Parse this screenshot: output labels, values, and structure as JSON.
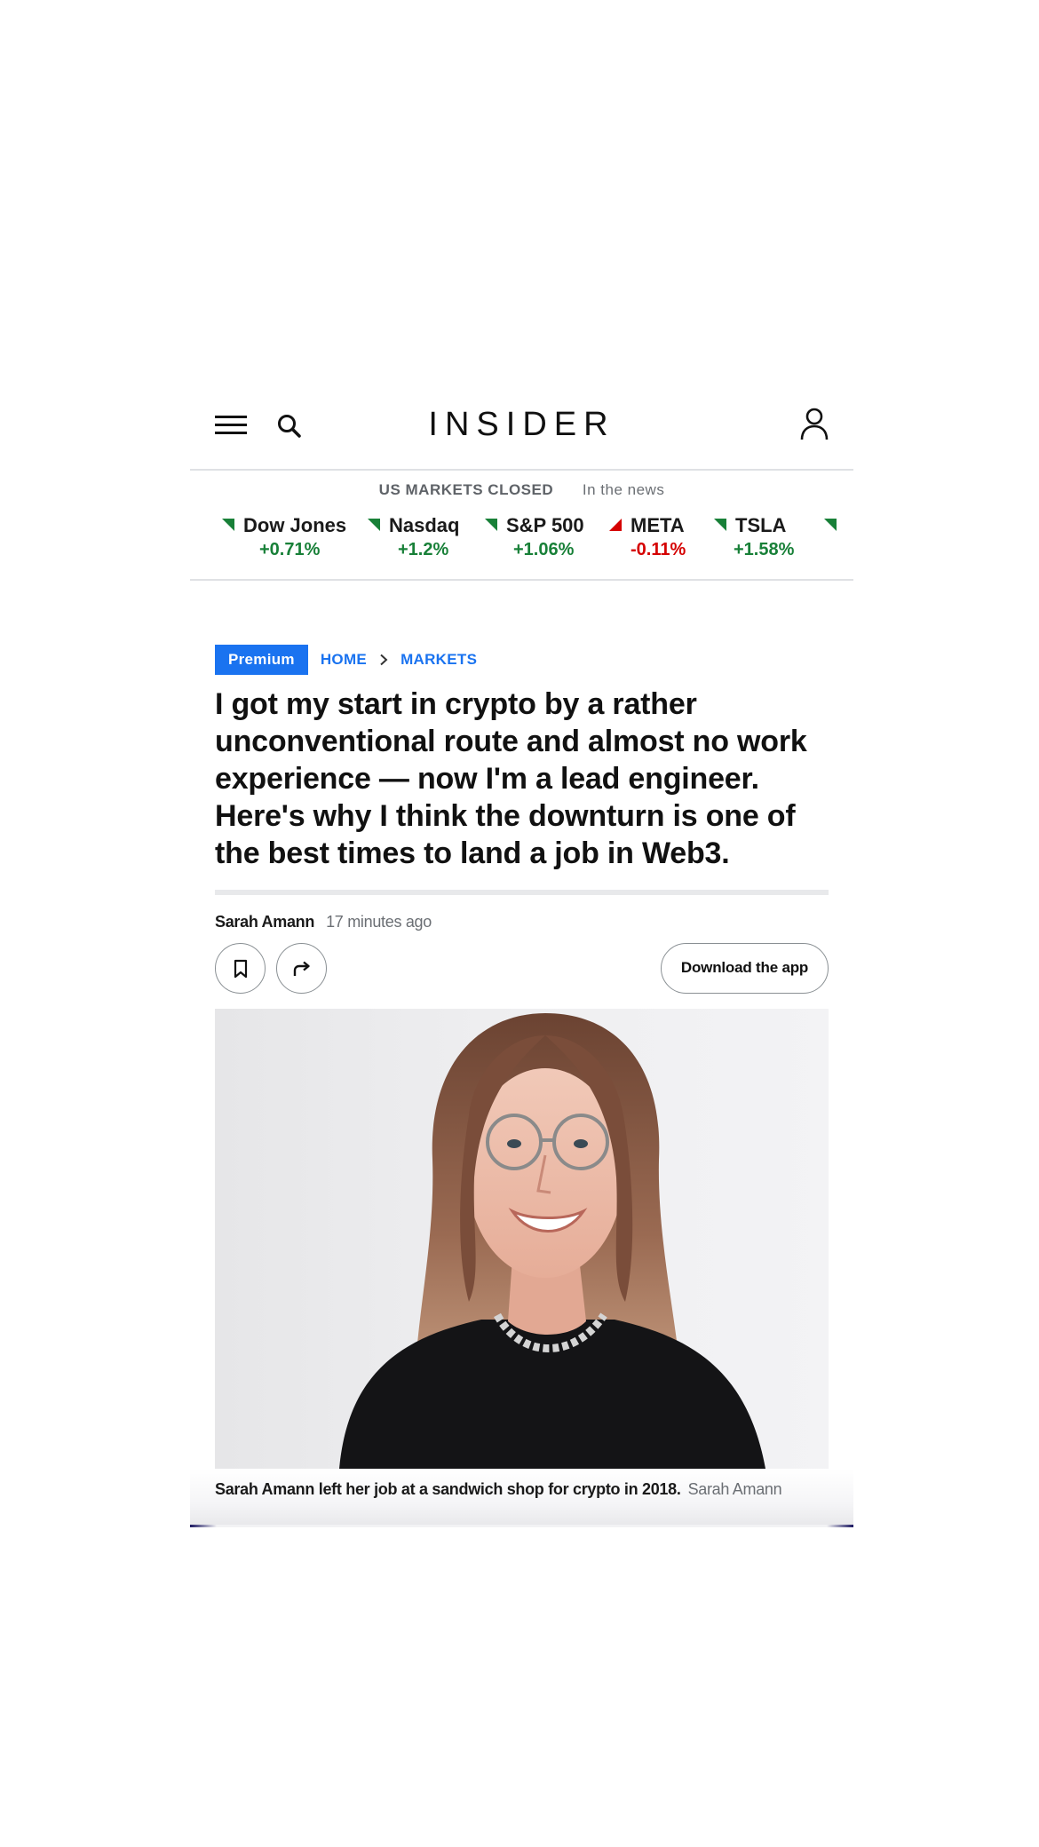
{
  "header": {
    "logo": "INSIDER",
    "icons": [
      "hamburger-menu-icon",
      "search-icon",
      "user-account-icon"
    ]
  },
  "markets": {
    "status": "US MARKETS CLOSED",
    "news_link": "In the news",
    "tickers": [
      {
        "name": "Dow Jones",
        "change": "+0.71%",
        "direction": "up"
      },
      {
        "name": "Nasdaq",
        "change": "+1.2%",
        "direction": "up"
      },
      {
        "name": "S&P 500",
        "change": "+1.06%",
        "direction": "up"
      },
      {
        "name": "META",
        "change": "-0.11%",
        "direction": "down"
      },
      {
        "name": "TSLA",
        "change": "+1.58%",
        "direction": "up"
      }
    ],
    "colors": {
      "up": "#188038",
      "down": "#d50000"
    }
  },
  "breadcrumb": {
    "badge": "Premium",
    "home": "HOME",
    "section": "MARKETS"
  },
  "article": {
    "headline": "I got my start in crypto by a rather unconventional route and almost no work experience — now I'm a lead engineer. Here's why I think the downturn is one of the best times to land a job in Web3.",
    "author": "Sarah Amann",
    "time": "17 minutes ago",
    "download_app": "Download the app",
    "caption": "Sarah Amann left her job at a sandwich shop for crypto in 2018.",
    "caption_credit": "Sarah Amann"
  },
  "colors": {
    "accent": "#1a73f0",
    "text": "#111111",
    "muted": "#6b6f74"
  }
}
